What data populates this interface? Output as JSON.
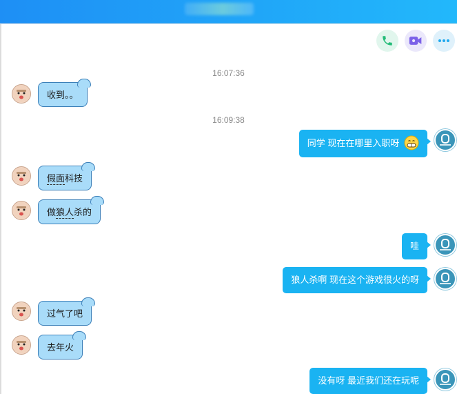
{
  "header": {
    "call_icon": "phone-icon",
    "video_icon": "video-camera-icon",
    "more_icon": "more-dots-icon",
    "call_color": "#22bb77",
    "video_color": "#7b61e8",
    "more_color": "#1ea8ee"
  },
  "messages": {
    "ts1": "16:07:36",
    "m1": "收到。。",
    "ts2": "16:09:38",
    "m2": "同学  现在在哪里入职呀",
    "m3_a": "假面",
    "m3_b": "科技",
    "m4_a": "做",
    "m4_b": "狼人",
    "m4_c": "杀的",
    "m5": "哇",
    "m6": "狼人杀啊   现在这个游戏很火的呀",
    "m7": "过气了吧",
    "m8": "去年火",
    "m9": "没有呀  最近我们还在玩呢"
  }
}
